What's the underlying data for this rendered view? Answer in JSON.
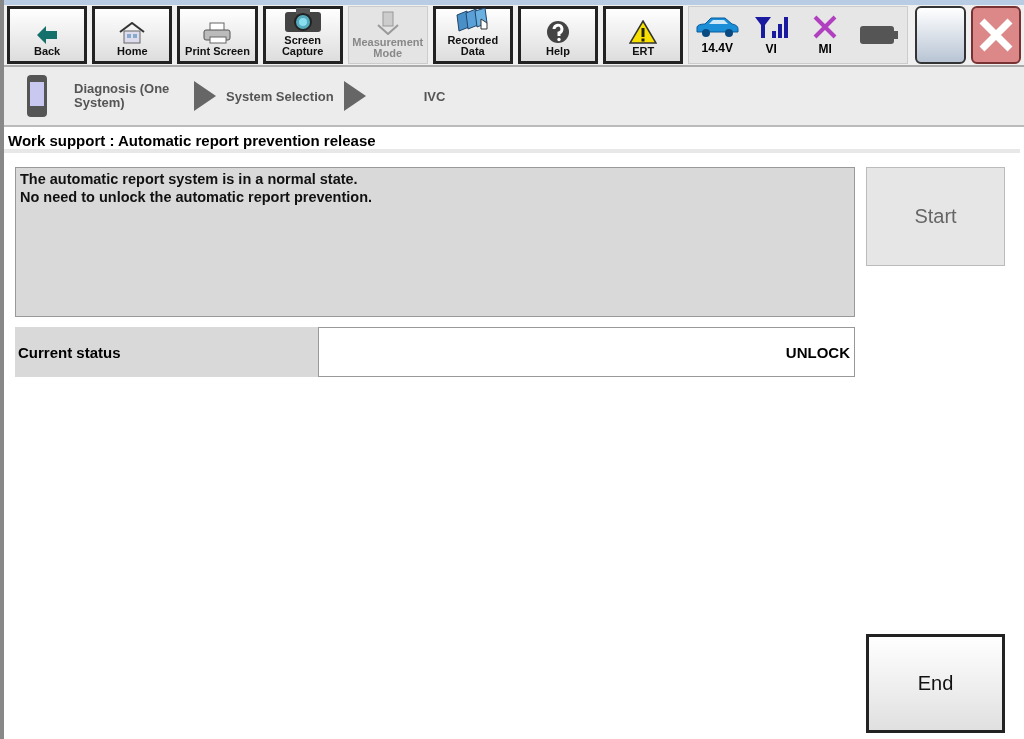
{
  "toolbar": {
    "buttons": [
      {
        "kind": "back",
        "label": "Back",
        "disabled": false
      },
      {
        "kind": "home",
        "label": "Home",
        "disabled": false
      },
      {
        "kind": "print",
        "label": "Print Screen",
        "disabled": false
      },
      {
        "kind": "camera",
        "label": "Screen Capture",
        "disabled": false
      },
      {
        "kind": "measure",
        "label": "Measurement Mode",
        "disabled": true
      },
      {
        "kind": "recorded",
        "label": "Recorded Data",
        "disabled": false
      },
      {
        "kind": "help",
        "label": "Help",
        "disabled": false
      },
      {
        "kind": "ert",
        "label": "ERT",
        "disabled": false
      }
    ],
    "status": [
      {
        "kind": "car",
        "label": "14.4V"
      },
      {
        "kind": "signal",
        "label": "VI"
      },
      {
        "kind": "cross",
        "label": "MI"
      },
      {
        "kind": "battery"
      }
    ]
  },
  "breadcrumb": [
    "Diagnosis (One System)",
    "System Selection",
    "IVC"
  ],
  "header": "Work support : Automatic report prevention release",
  "message": [
    "The automatic report system is in a normal state.",
    "No need to unlock the automatic report prevention."
  ],
  "start_button": {
    "label": "Start",
    "disabled": true
  },
  "current_status": {
    "label": "Current status",
    "value": "UNLOCK"
  },
  "end_button": {
    "label": "End",
    "disabled": false
  }
}
